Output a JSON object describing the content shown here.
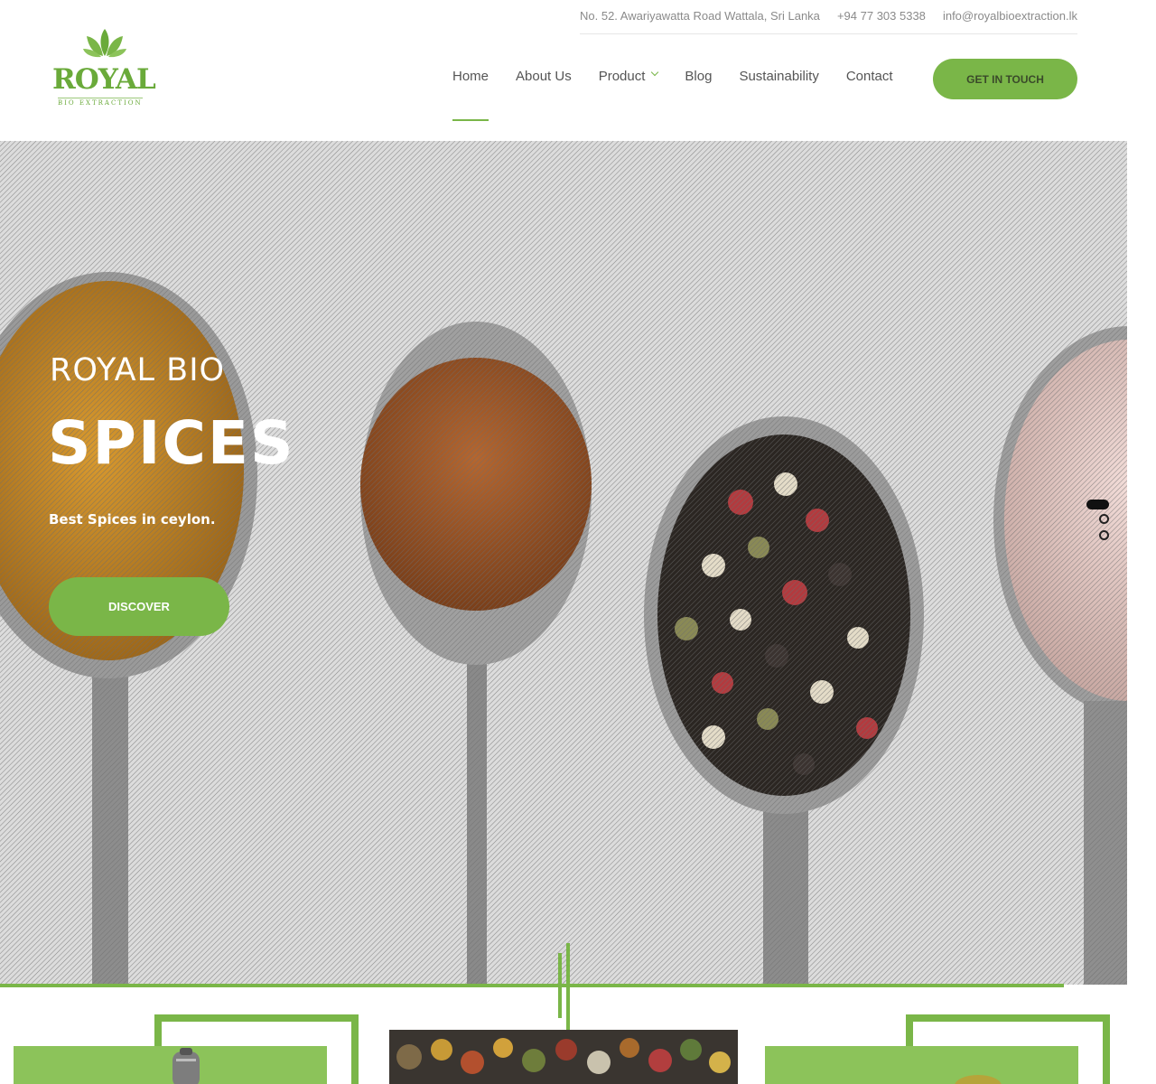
{
  "brand": {
    "wordmark": "ROYAL",
    "tagline": "BIO EXTRACTION",
    "accent_color": "#7ab648"
  },
  "topbar": {
    "address": "No. 52. Awariyawatta Road Wattala, Sri Lanka",
    "phone": "+94 77 303 5338",
    "email": "info@royalbioextraction.lk"
  },
  "nav": {
    "items": [
      {
        "label": "Home",
        "active": true
      },
      {
        "label": "About Us"
      },
      {
        "label": "Product",
        "has_dropdown": true,
        "dropdown_icon": "chevron-down-icon"
      },
      {
        "label": "Blog"
      },
      {
        "label": "Sustainability"
      },
      {
        "label": "Contact"
      }
    ],
    "cta_label": "GET IN TOUCH"
  },
  "hero": {
    "eyebrow": "ROYAL BIO",
    "title": "SPICES",
    "subtitle": "Best Spices in ceylon.",
    "button_label": "DISCOVER",
    "slider": {
      "total": 3,
      "active": 1
    }
  }
}
